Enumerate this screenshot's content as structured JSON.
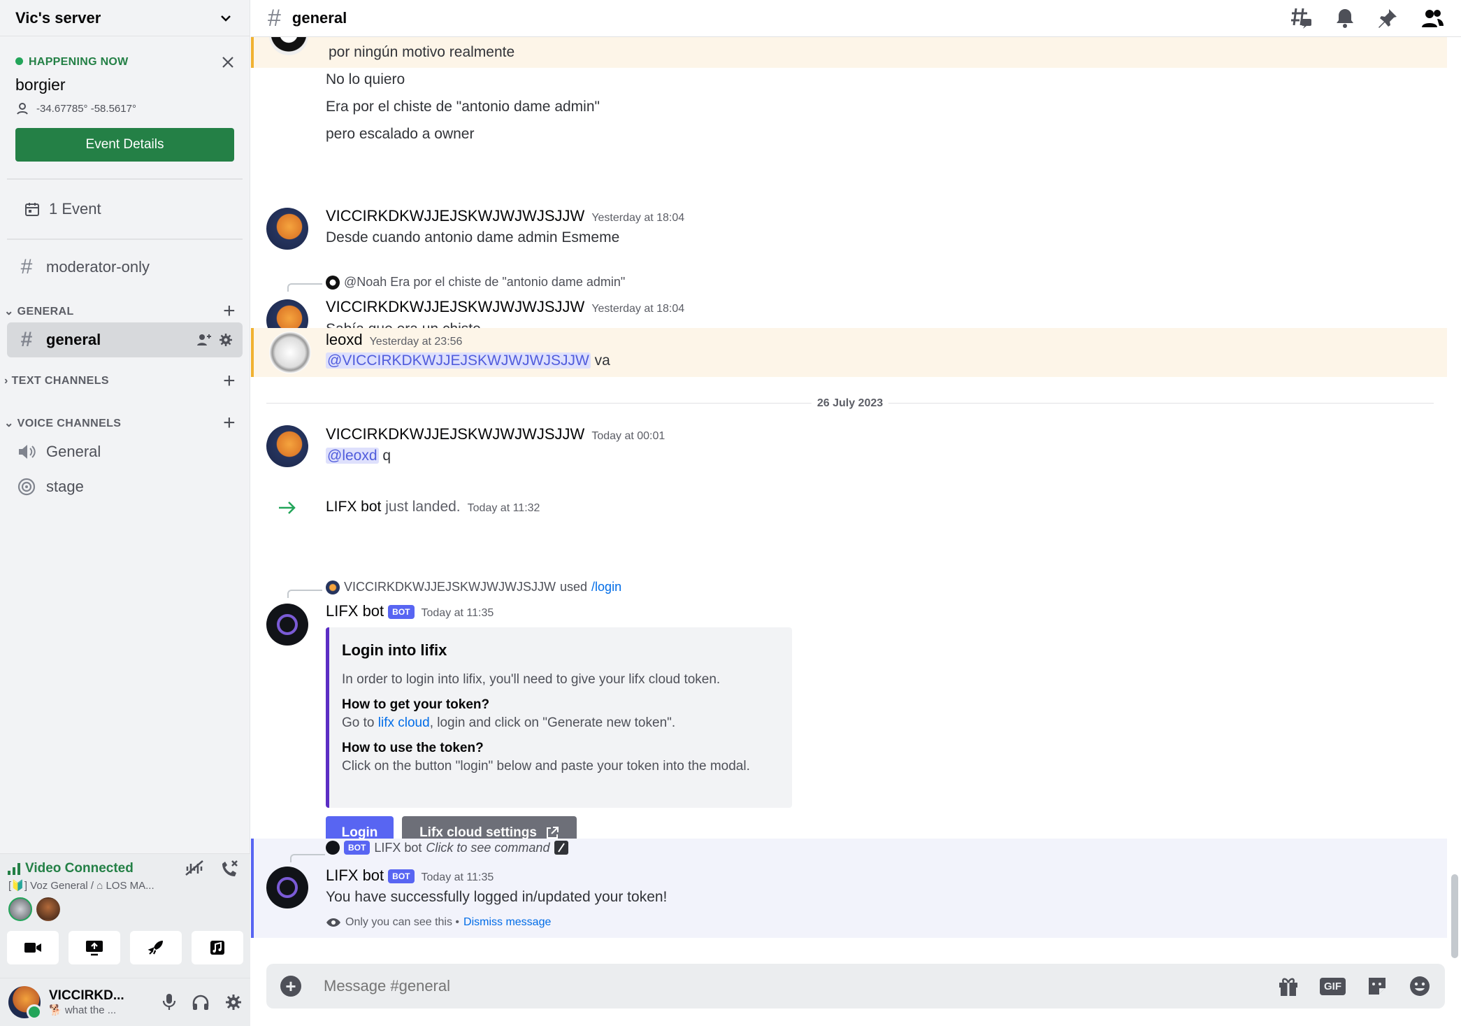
{
  "sidebar": {
    "server_name": "Vic's server",
    "event": {
      "status": "HAPPENING NOW",
      "name": "borgier",
      "location": "-34.67785° -58.5617°",
      "button": "Event Details"
    },
    "events_count": "1 Event",
    "channels": [
      {
        "name": "moderator-only"
      },
      {
        "name": "general"
      },
      {
        "name": "General"
      },
      {
        "name": "stage"
      }
    ],
    "categories": [
      "GENERAL",
      "TEXT CHANNELS",
      "VOICE CHANNELS"
    ],
    "voice": {
      "status": "Video Connected",
      "location": "[🔰] Voz General / ⌂ LOS MA..."
    },
    "user": {
      "name": "VICCIRKD...",
      "status": "🐕 what the ..."
    }
  },
  "header": {
    "channel": "general"
  },
  "messages": [
    {
      "text": "por ningún motivo realmente"
    },
    {
      "text": "No lo quiero"
    },
    {
      "text": "Era por el chiste de \"antonio dame admin\""
    },
    {
      "text": "pero escalado a owner"
    },
    {
      "author": "VICCIRKDKWJJEJSKWJWJWJSJJW",
      "time": "Yesterday at 18:04",
      "text": "Desde cuando antonio dame admin Esmeme"
    },
    {
      "reply": "@Noah Era por el chiste de \"antonio dame admin\"",
      "author": "VICCIRKDKWJJEJSKWJWJWJSJJW",
      "time": "Yesterday at 18:04",
      "text": "Sabía que era un chiste"
    },
    {
      "author": "leoxd",
      "time": "Yesterday at 23:56",
      "mention": "@VICCIRKDKWJJEJSKWJWJWJSJJW",
      "text": "va"
    },
    {
      "divider": "26 July 2023"
    },
    {
      "author": "VICCIRKDKWJJEJSKWJWJWJSJJW",
      "time": "Today at 00:01",
      "mention": "@leoxd",
      "text": "q"
    },
    {
      "join_name": "LIFX bot",
      "join_text": "just landed.",
      "time": "Today at 11:32"
    },
    {
      "reply_user": "VICCIRKDKWJJEJSKWJWJWJSJJW",
      "reply_used": "used",
      "reply_cmd": "/login",
      "author": "LIFX bot",
      "tag": "BOT",
      "time": "Today at 11:35"
    },
    {
      "reply_tag": "BOT",
      "reply_user": "LIFX bot",
      "reply_hint": "Click to see command",
      "author": "LIFX bot",
      "tag": "BOT",
      "time": "Today at 11:35",
      "text": "You have successfully logged in/updated your token!",
      "only": "Only you can see this •",
      "dismiss": "Dismiss message"
    }
  ],
  "embed": {
    "title": "Login into lifix",
    "description": "In order to login into lifix, you'll need to give your lifx cloud token.",
    "field1_name": "How to get your token?",
    "field1_pre": "Go to",
    "field1_link": "lifx cloud",
    "field1_post": ", login and click on \"Generate new token\".",
    "field2_name": "How to use the token?",
    "field2_value": "Click on the button \"login\" below and paste your token into the modal.",
    "btn_login": "Login",
    "btn_settings": "Lifx cloud settings"
  },
  "composer": {
    "placeholder": "Message #general",
    "gif": "GIF"
  },
  "colors": {
    "accent": "#5865f2",
    "green": "#248046",
    "highlight": "#fdf5e8"
  }
}
